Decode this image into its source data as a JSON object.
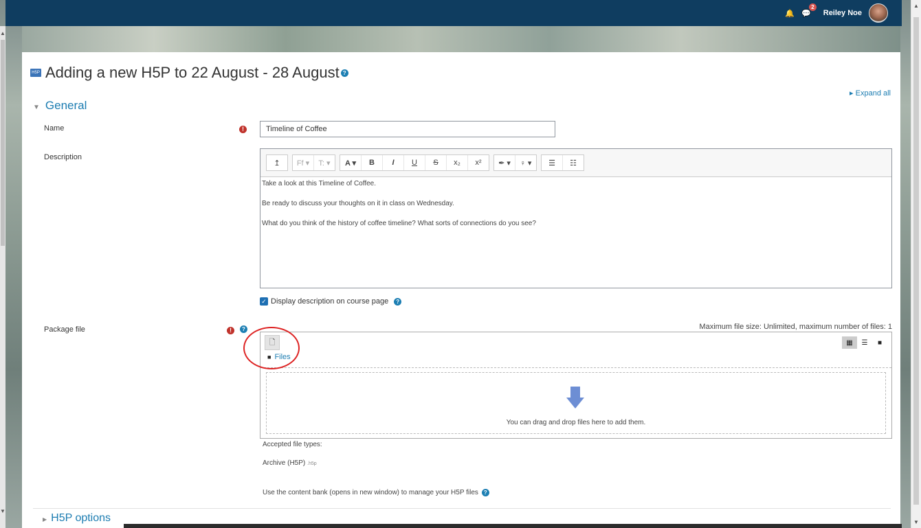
{
  "topbar": {
    "notifications_count": "2",
    "user_name": "Reiley Noe"
  },
  "page": {
    "title": "Adding a new H5P to 22 August - 28 August",
    "expand_all": "Expand all"
  },
  "general": {
    "section_title": "General",
    "name_label": "Name",
    "name_value": "Timeline of Coffee",
    "description_label": "Description",
    "description_paragraphs": [
      "Take a look at this Timeline of Coffee.",
      "Be ready to discuss your thoughts on it in class on Wednesday.",
      "What do you think of the history of coffee timeline? What sorts of connections do you see?"
    ],
    "display_description_label": "Display description on course page",
    "display_description_checked": true
  },
  "editor_toolbar": {
    "buttons": [
      "↥",
      "Ff ▾",
      "T: ▾",
      "A ▾",
      "B",
      "I",
      "U",
      "S",
      "x₂",
      "x²",
      "✒ ▾",
      "♀ ▾",
      "☰",
      "☷"
    ]
  },
  "package": {
    "label": "Package file",
    "max_size_text": "Maximum file size: Unlimited, maximum number of files: 1",
    "files_crumb": "Files",
    "drop_text": "You can drag and drop files here to add them.",
    "accepted_label": "Accepted file types:",
    "archive_label": "Archive (H5P)",
    "archive_ext": ".h5p",
    "content_bank_text": "Use the content bank (opens in new window) to manage your H5P files"
  },
  "h5p_options": {
    "section_title": "H5P options"
  },
  "colors": {
    "navbar": "#0f3d60",
    "link": "#1b7cb1",
    "required": "#c0322b",
    "annotation_circle": "#dd2222"
  }
}
